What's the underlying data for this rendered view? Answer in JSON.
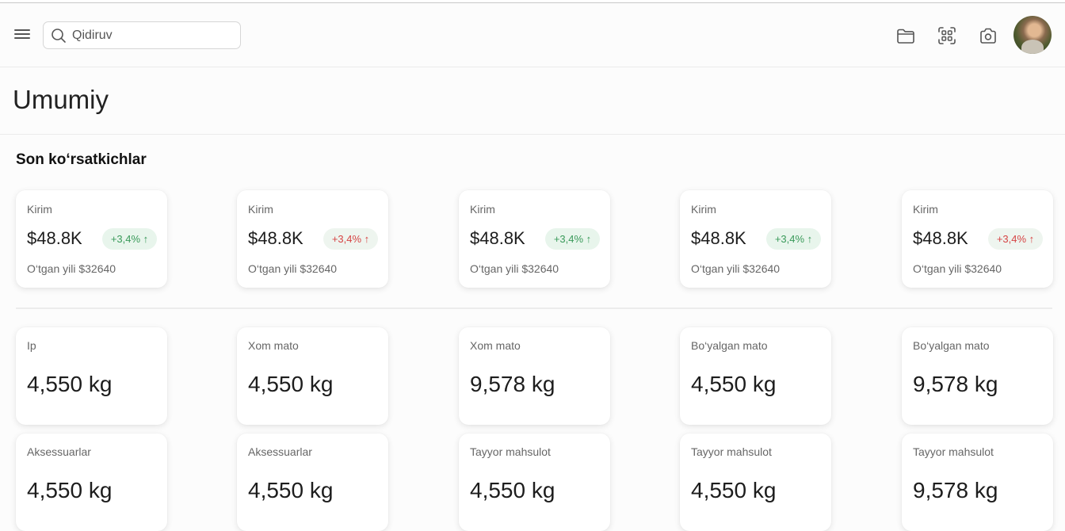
{
  "header": {
    "search_placeholder": "Qidiruv",
    "icons": [
      "menu-icon",
      "search-icon",
      "folder-icon",
      "scan-icon",
      "camera-icon"
    ]
  },
  "page": {
    "title": "Umumiy",
    "section_title": "Son ko‘rsatkichlar"
  },
  "stats": [
    {
      "label": "Kirim",
      "value": "$48.8K",
      "change": "+3,4%",
      "direction": "up",
      "sub": "O‘tgan yili $32640"
    },
    {
      "label": "Kirim",
      "value": "$48.8K",
      "change": "+3,4%",
      "direction": "down",
      "sub": "O‘tgan yili $32640"
    },
    {
      "label": "Kirim",
      "value": "$48.8K",
      "change": "+3,4%",
      "direction": "up",
      "sub": "O‘tgan yili $32640"
    },
    {
      "label": "Kirim",
      "value": "$48.8K",
      "change": "+3,4%",
      "direction": "up",
      "sub": "O‘tgan yili $32640"
    },
    {
      "label": "Kirim",
      "value": "$48.8K",
      "change": "+3,4%",
      "direction": "down",
      "sub": "O‘tgan yili $32640"
    }
  ],
  "inventory_row1": [
    {
      "label": "Ip",
      "value": "4,550 kg"
    },
    {
      "label": "Xom mato",
      "value": "4,550 kg"
    },
    {
      "label": "Xom mato",
      "value": "9,578 kg"
    },
    {
      "label": "Bo‘yalgan mato",
      "value": "4,550 kg"
    },
    {
      "label": "Bo‘yalgan mato",
      "value": "9,578 kg"
    }
  ],
  "inventory_row2": [
    {
      "label": "Aksessuarlar",
      "value": "4,550 kg"
    },
    {
      "label": "Aksessuarlar",
      "value": "4,550 kg"
    },
    {
      "label": "Tayyor mahsulot",
      "value": "4,550 kg"
    },
    {
      "label": "Tayyor mahsulot",
      "value": "4,550 kg"
    },
    {
      "label": "Tayyor mahsulot",
      "value": "9,578 kg"
    }
  ],
  "colors": {
    "up": "#3a9a5a",
    "down": "#d64545",
    "accent_bg": "#e8f5ec"
  }
}
